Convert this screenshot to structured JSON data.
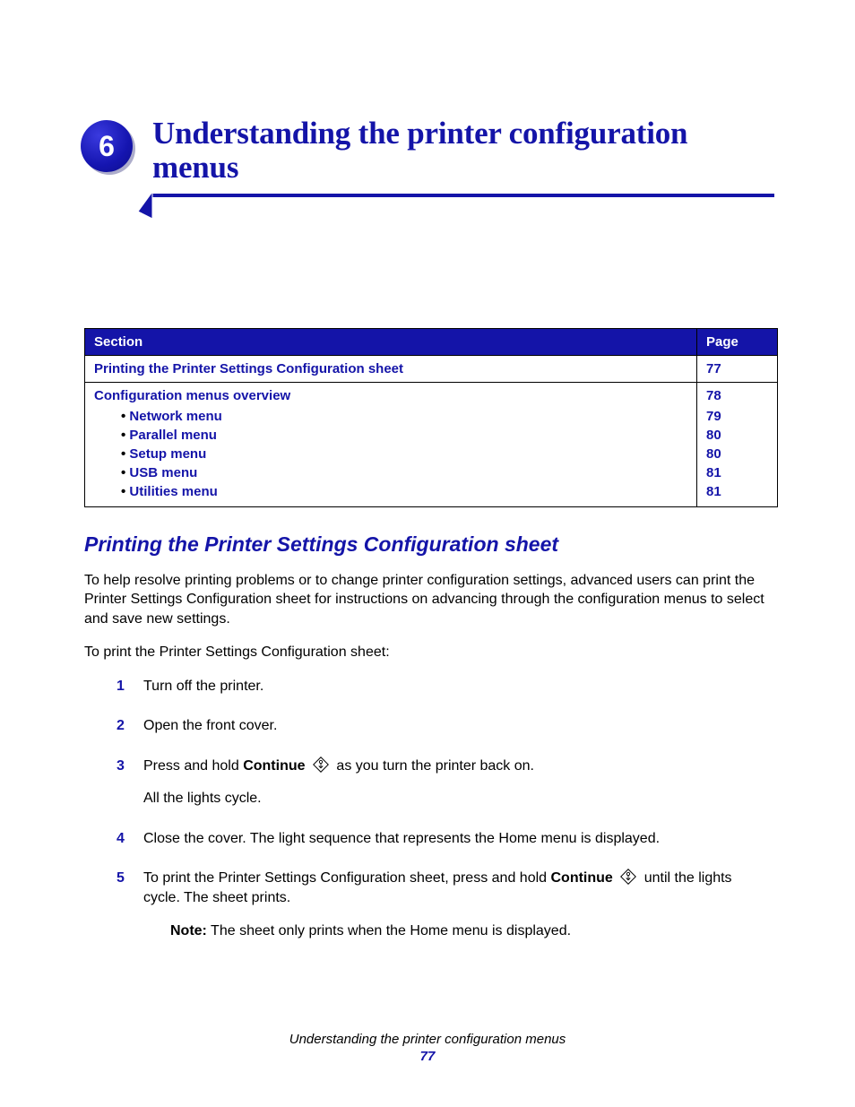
{
  "chapter": {
    "number": "6",
    "title": "Understanding the printer configuration menus"
  },
  "toc": {
    "headers": {
      "section": "Section",
      "page": "Page"
    },
    "rows": [
      {
        "label": "Printing the Printer Settings Configuration sheet",
        "page": "77"
      },
      {
        "label": "Configuration menus overview",
        "page": "78",
        "children": [
          {
            "label": "Network menu",
            "page": "79"
          },
          {
            "label": "Parallel menu",
            "page": "80"
          },
          {
            "label": "Setup menu",
            "page": "80"
          },
          {
            "label": "USB menu",
            "page": "81"
          },
          {
            "label": "Utilities menu",
            "page": "81"
          }
        ]
      }
    ]
  },
  "section_heading": "Printing the Printer Settings Configuration sheet",
  "intro": "To help resolve printing problems or to change printer configuration settings, advanced users can print the Printer Settings Configuration sheet for instructions on advancing through the configuration menus to select and save new settings.",
  "lead": "To print the Printer Settings Configuration sheet:",
  "steps": {
    "s1": "Turn off the printer.",
    "s2": "Open the front cover.",
    "s3_a": "Press and hold ",
    "s3_bold": "Continue",
    "s3_b": " as you turn the printer back on.",
    "s3_sub": "All the lights cycle.",
    "s4": "Close the cover. The light sequence that represents the Home menu is displayed.",
    "s5_a": "To print the Printer Settings Configuration sheet, press and hold ",
    "s5_bold": "Continue",
    "s5_b": " until the lights cycle. The sheet prints.",
    "s5_note_label": "Note:",
    "s5_note": " The sheet only prints when the Home menu is displayed."
  },
  "footer": {
    "title": "Understanding the printer configuration menus",
    "page": "77"
  }
}
